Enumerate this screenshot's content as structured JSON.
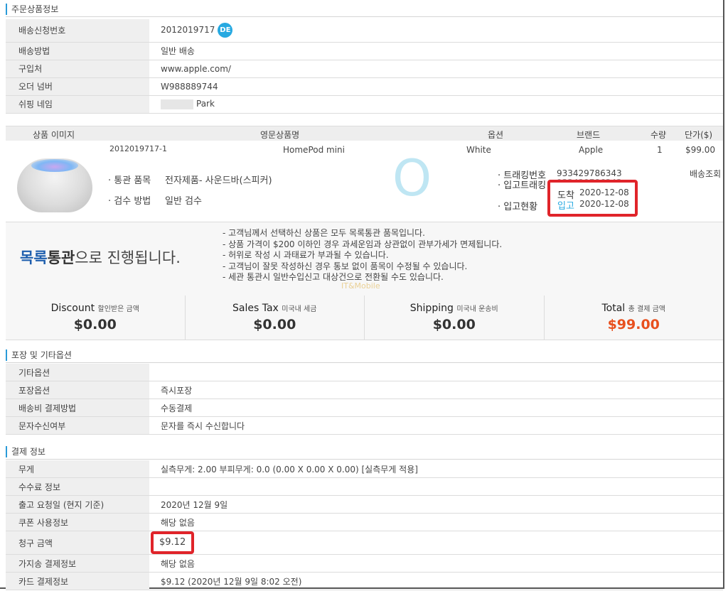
{
  "order_info": {
    "title": "주문상품정보",
    "rows": [
      {
        "label": "배송신청번호",
        "value": "2012019717",
        "badge": "DE"
      },
      {
        "label": "배송방법",
        "value": "일반 배송"
      },
      {
        "label": "구입처",
        "value": "www.apple.com/"
      },
      {
        "label": "오더 넘버",
        "value": "W988889744"
      },
      {
        "label": "쉬핑 네임",
        "value": "Park"
      }
    ]
  },
  "products": {
    "headers": [
      "상품 이미지",
      "영문상품명",
      "옵션",
      "브랜드",
      "수량",
      "단가($)"
    ],
    "item": {
      "code": "2012019717-1",
      "name": "HomePod mini",
      "option": "White",
      "brand": "Apple",
      "qty": "1",
      "price": "$99.00",
      "customs_label": "· 통관 품목",
      "customs_value": "전자제품- 사운드바(스피커)",
      "inspect_label": "· 검수 방법",
      "inspect_value": "일반 검수",
      "tracking_label": "· 트래킹번호",
      "tracking_value": "933429786343",
      "track_link": "배송조회",
      "inbound_tracking_label": "· 입고트래킹",
      "inbound_tracking_value": "933429786343",
      "arrival_label": "도착",
      "arrival_date": "2020-12-08",
      "inbound_status_label": "· 입고현황",
      "inbound_label": "입고",
      "inbound_date": "2020-12-08",
      "big_mark": "O"
    }
  },
  "notice": {
    "title_part1": "목록",
    "title_part2": "통관",
    "title_part3": "으로 진행됩니다.",
    "lines": [
      "- 고객님께서 선택하신 상품은 모두 목록통관 품목입니다.",
      "- 상품 가격이 $200 이하인 경우 과세운임과 상관없이 관부가세가 면제됩니다.",
      "- 허위로 작성 시 과태료가 부과될 수 있습니다.",
      "- 고객님이 잘못 작성하신 경우 통보 없이 품목이 수정될 수 있습니다.",
      "- 세관 통관시 일반수입신고 대상건으로 전환될 수도 있습니다."
    ],
    "watermark": "IT&Mobile"
  },
  "summary": [
    {
      "label": "Discount",
      "sub": "할인받은 금액",
      "value": "$0.00"
    },
    {
      "label": "Sales Tax",
      "sub": "미국내 세금",
      "value": "$0.00"
    },
    {
      "label": "Shipping",
      "sub": "미국내 운송비",
      "value": "$0.00"
    },
    {
      "label": "Total",
      "sub": "총 결제 금액",
      "value": "$99.00"
    }
  ],
  "packaging": {
    "title": "포장 및 기타옵션",
    "rows": [
      {
        "label": "기타옵션",
        "value": ""
      },
      {
        "label": "포장옵션",
        "value": "즉시포장"
      },
      {
        "label": "배송비 결제방법",
        "value": "수동결제"
      },
      {
        "label": "문자수신여부",
        "value": "문자를 즉시 수신합니다"
      }
    ]
  },
  "payment": {
    "title": "결제 정보",
    "rows": [
      {
        "label": "무게",
        "value": "실측무게: 2.00 부피무게: 0.0 (0.00 X 0.00 X 0.00) [실측무게 적용]"
      },
      {
        "label": "수수료 정보",
        "value": ""
      },
      {
        "label": "출고 요청일 (현지 기준)",
        "value": "2020년 12월 9일"
      },
      {
        "label": "쿠폰 사용정보",
        "value": "해당 없음"
      },
      {
        "label": "청구 금액",
        "value": "$9.12"
      },
      {
        "label": "가지송 결제정보",
        "value": "해당 없음"
      },
      {
        "label": "카드 결제정보",
        "value": "$9.12 (2020년 12월 9일 8:02 오전)"
      }
    ]
  },
  "colors": {
    "accent": "#2a9bd8",
    "highlight_box": "#e0242a",
    "total": "#e8501e",
    "link": "#27a9e1"
  }
}
